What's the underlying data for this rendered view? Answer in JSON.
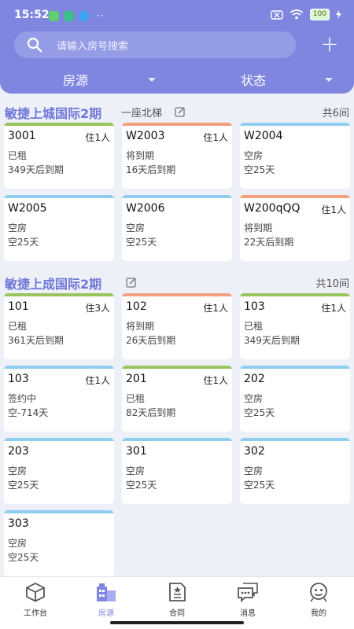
{
  "status_bar": {
    "time": "15:52",
    "more": "··",
    "battery": "100"
  },
  "search": {
    "placeholder": "请输入房号搜索"
  },
  "actions": {
    "add": "+"
  },
  "filters": [
    {
      "label": "房源"
    },
    {
      "label": "状态"
    }
  ],
  "colors": {
    "rented": "#97c45b",
    "due": "#f3a07e",
    "vacant": "#8fcdf0",
    "accent": "#7e86e0"
  },
  "sections": [
    {
      "title": "敏捷上城国际2期",
      "subtitle": "一座北梯",
      "count": "共6间",
      "rooms": [
        {
          "room": "3001",
          "occupants": "住1人",
          "status": "已租",
          "due": "349天后到期",
          "kind": "rented"
        },
        {
          "room": "W2003",
          "occupants": "住1人",
          "status": "将到期",
          "due": "16天后到期",
          "kind": "due"
        },
        {
          "room": "W2004",
          "occupants": "",
          "status": "空房",
          "due": "空25天",
          "kind": "vacant"
        },
        {
          "room": "W2005",
          "occupants": "",
          "status": "空房",
          "due": "空25天",
          "kind": "vacant"
        },
        {
          "room": "W2006",
          "occupants": "",
          "status": "空房",
          "due": "空25天",
          "kind": "vacant"
        },
        {
          "room": "W200qQQ",
          "occupants": "住1人",
          "status": "将到期",
          "due": "22天后到期",
          "kind": "due"
        }
      ]
    },
    {
      "title": "敏捷上成国际2期",
      "subtitle": "",
      "count": "共10间",
      "rooms": [
        {
          "room": "101",
          "occupants": "住3人",
          "status": "已租",
          "due": "361天后到期",
          "kind": "rented"
        },
        {
          "room": "102",
          "occupants": "住1人",
          "status": "将到期",
          "due": "26天后到期",
          "kind": "due"
        },
        {
          "room": "103",
          "occupants": "住1人",
          "status": "已租",
          "due": "349天后到期",
          "kind": "rented"
        },
        {
          "room": "103",
          "occupants": "住1人",
          "status": "签约中",
          "due": "空-714天",
          "kind": "vacant"
        },
        {
          "room": "201",
          "occupants": "住1人",
          "status": "已租",
          "due": "82天后到期",
          "kind": "rented"
        },
        {
          "room": "202",
          "occupants": "",
          "status": "空房",
          "due": "空25天",
          "kind": "vacant"
        },
        {
          "room": "203",
          "occupants": "",
          "status": "空房",
          "due": "空25天",
          "kind": "vacant"
        },
        {
          "room": "301",
          "occupants": "",
          "status": "空房",
          "due": "空25天",
          "kind": "vacant"
        },
        {
          "room": "302",
          "occupants": "",
          "status": "空房",
          "due": "空25天",
          "kind": "vacant"
        },
        {
          "room": "303",
          "occupants": "",
          "status": "空房",
          "due": "空25天",
          "kind": "vacant"
        }
      ]
    }
  ],
  "tabs": [
    {
      "label": "工作台",
      "icon": "cube-icon",
      "active": false
    },
    {
      "label": "房源",
      "icon": "building-icon",
      "active": true
    },
    {
      "label": "合同",
      "icon": "contract-icon",
      "active": false
    },
    {
      "label": "消息",
      "icon": "message-icon",
      "active": false
    },
    {
      "label": "我的",
      "icon": "profile-icon",
      "active": false
    }
  ]
}
